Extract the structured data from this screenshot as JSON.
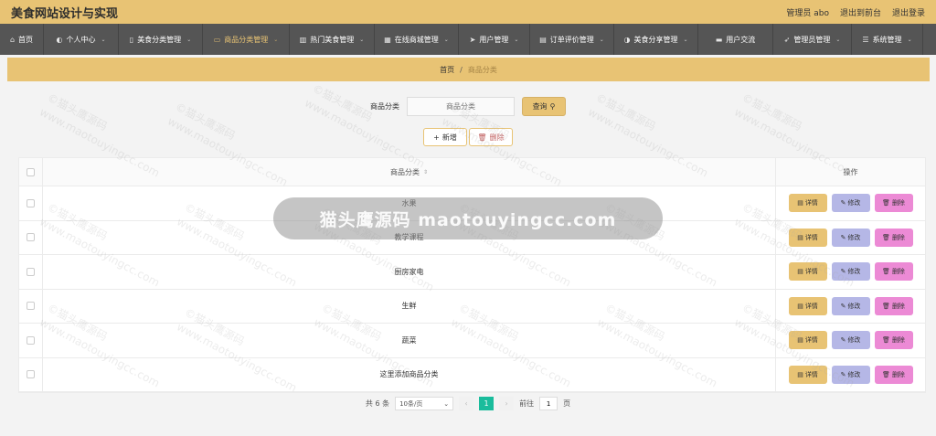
{
  "header": {
    "title": "美食网站设计与实现",
    "user": "管理员 abo",
    "to_front": "退出到前台",
    "logout": "退出登录"
  },
  "nav": [
    {
      "label": "首页",
      "icon": "home-icon",
      "glyph": "⌂",
      "active": false,
      "has_menu": false,
      "w": 48
    },
    {
      "label": "个人中心",
      "icon": "user-icon",
      "glyph": "◐",
      "active": false,
      "has_menu": true,
      "w": 82
    },
    {
      "label": "美食分类管理",
      "icon": "mobile-icon",
      "glyph": "▯",
      "active": false,
      "has_menu": true,
      "w": 92
    },
    {
      "label": "商品分类管理",
      "icon": "monitor-icon",
      "glyph": "▭",
      "active": true,
      "has_menu": true,
      "w": 95
    },
    {
      "label": "热门美食管理",
      "icon": "chart-icon",
      "glyph": "▥",
      "active": false,
      "has_menu": true,
      "w": 93
    },
    {
      "label": "在线商城管理",
      "icon": "grid-icon",
      "glyph": "▦",
      "active": false,
      "has_menu": true,
      "w": 92
    },
    {
      "label": "用户管理",
      "icon": "send-icon",
      "glyph": "➤",
      "active": false,
      "has_menu": true,
      "w": 78
    },
    {
      "label": "订单评价管理",
      "icon": "card-icon",
      "glyph": "▤",
      "active": false,
      "has_menu": true,
      "w": 92
    },
    {
      "label": "美食分享管理",
      "icon": "person-icon",
      "glyph": "◑",
      "active": false,
      "has_menu": true,
      "w": 92
    },
    {
      "label": "用户交流",
      "icon": "comment-icon",
      "glyph": "▬",
      "active": false,
      "has_menu": false,
      "w": 82
    },
    {
      "label": "管理员管理",
      "icon": "pointer-icon",
      "glyph": "➶",
      "active": false,
      "has_menu": true,
      "w": 86
    },
    {
      "label": "系统管理",
      "icon": "list-icon",
      "glyph": "☰",
      "active": false,
      "has_menu": true,
      "w": 78
    }
  ],
  "breadcrumb": {
    "home": "首页",
    "separator": "/",
    "current": "商品分类"
  },
  "search": {
    "label": "商品分类",
    "placeholder": "商品分类",
    "query_button": "查询"
  },
  "actions": {
    "add": "新增",
    "delete": "删除"
  },
  "table": {
    "column_name": "商品分类",
    "column_ops": "操作",
    "rows": [
      "水果",
      "教学课程",
      "厨房家电",
      "生鲜",
      "蔬菜",
      "这里添加商品分类"
    ],
    "op_detail": "详情",
    "op_edit": "修改",
    "op_delete": "删除"
  },
  "pagination": {
    "total": "共 6 条",
    "page_size": "10条/页",
    "current_page": "1",
    "goto_label": "前往",
    "goto_value": "1",
    "page_unit": "页"
  },
  "watermark": {
    "banner": "猫头鹰源码 maotouyingcc.com",
    "tile_line1": "©猫头鹰源码",
    "tile_line2": "www.maotouyingcc.com"
  },
  "colors": {
    "accent": "#e8c374",
    "nav_bg": "#555555",
    "edit": "#b5b7e6",
    "delete": "#ec8ad5",
    "page_active": "#1abc9c"
  }
}
